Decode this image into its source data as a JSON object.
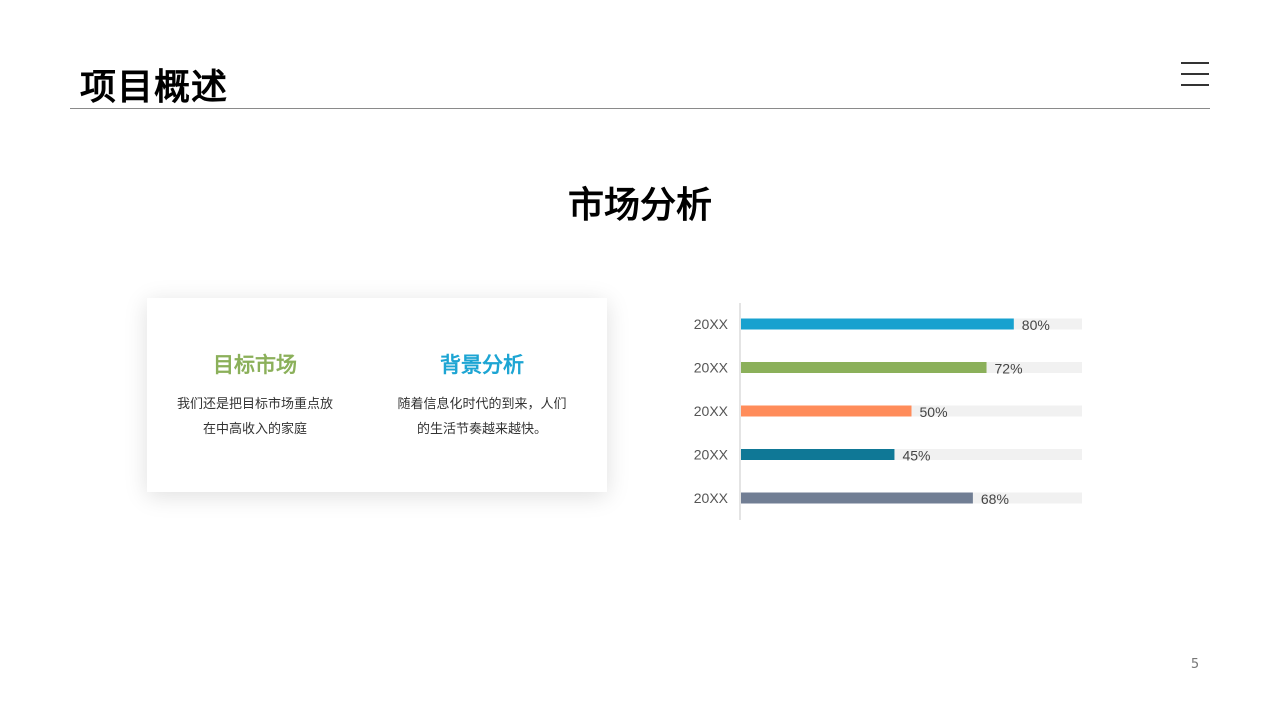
{
  "header": {
    "title": "项目概述"
  },
  "section": {
    "title": "市场分析"
  },
  "card": {
    "left": {
      "heading": "目标市场",
      "line1": "我们还是把目标市场重点放",
      "line2": "在中高收入的家庭"
    },
    "right": {
      "heading": "背景分析",
      "line1": "随着信息化时代的到来，人们",
      "line2": "的生活节奏越来越快。"
    }
  },
  "page_number": "5",
  "colors": {
    "green_heading": "#8bb05a",
    "blue_heading": "#1da5d3",
    "track": "#f1f1f1",
    "axis": "#c8c8c8"
  },
  "icons": [
    "menu-icon"
  ],
  "chart_data": {
    "type": "bar",
    "orientation": "horizontal",
    "categories": [
      "20XX",
      "20XX",
      "20XX",
      "20XX",
      "20XX"
    ],
    "values": [
      80,
      72,
      50,
      45,
      68
    ],
    "value_labels": [
      "80%",
      "72%",
      "50%",
      "45%",
      "68%"
    ],
    "bar_colors": [
      "#17a1cf",
      "#8bb05a",
      "#ff8c5a",
      "#0f7896",
      "#717e94"
    ],
    "xlim": [
      0,
      100
    ],
    "background_track": true,
    "grid": false,
    "legend": "none"
  }
}
